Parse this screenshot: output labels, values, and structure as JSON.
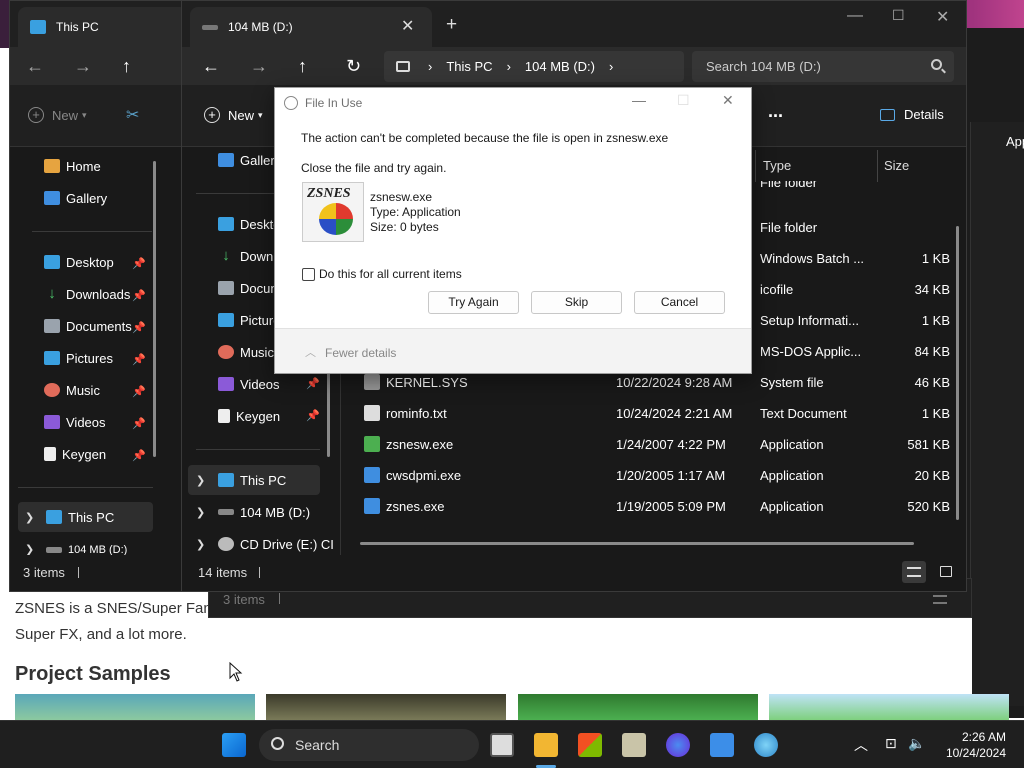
{
  "web": {
    "line1": "ZSNES is a SNES/Super Fam",
    "line2": "Super FX, and a lot more.",
    "heading": "Project Samples"
  },
  "ghost_app": {
    "label": "App"
  },
  "window1": {
    "tab_title": "This PC",
    "new_label": "New",
    "sidebar": [
      {
        "label": "Home",
        "icon": "home-icon"
      },
      {
        "label": "Gallery",
        "icon": "gallery-icon"
      },
      {
        "label": "Desktop",
        "icon": "desktop-icon"
      },
      {
        "label": "Downloads",
        "icon": "download-icon"
      },
      {
        "label": "Documents",
        "icon": "document-icon"
      },
      {
        "label": "Pictures",
        "icon": "pictures-icon"
      },
      {
        "label": "Music",
        "icon": "music-icon"
      },
      {
        "label": "Videos",
        "icon": "videos-icon"
      },
      {
        "label": "Keygen",
        "icon": "file-icon"
      },
      {
        "label": "This PC",
        "icon": "pc-icon"
      },
      {
        "label": "104 MB (D:)",
        "icon": "drive-icon"
      }
    ],
    "status": "3 items"
  },
  "window3": {
    "status": "3 items"
  },
  "window2": {
    "tab_title": "104 MB (D:)",
    "add_tab": "+",
    "breadcrumb": [
      "This PC",
      "104 MB (D:)"
    ],
    "search_placeholder": "Search 104 MB (D:)",
    "new_label": "New",
    "more_label": "...",
    "details_label": "Details",
    "sidebar": [
      {
        "label": "Gallery"
      },
      {
        "label": "Deskto"
      },
      {
        "label": "Downl"
      },
      {
        "label": "Docun"
      },
      {
        "label": "Picture"
      },
      {
        "label": "Music"
      },
      {
        "label": "Videos"
      },
      {
        "label": "Keygen"
      },
      {
        "label": "This PC"
      },
      {
        "label": "104 MB (D:)"
      },
      {
        "label": "CD Drive (E:) CI"
      }
    ],
    "columns": {
      "type": "Type",
      "size": "Size"
    },
    "rows": [
      {
        "name": "",
        "date": "",
        "type": "File folder",
        "size": ""
      },
      {
        "name": "",
        "date": "",
        "type": "File folder",
        "size": ""
      },
      {
        "name": "",
        "date": "",
        "type": "Windows Batch ...",
        "size": "1 KB"
      },
      {
        "name": "",
        "date": "",
        "type": "icofile",
        "size": "34 KB"
      },
      {
        "name": "",
        "date": "",
        "type": "Setup Informati...",
        "size": "1 KB"
      },
      {
        "name": "",
        "date": "",
        "type": "MS-DOS Applic...",
        "size": "84 KB"
      },
      {
        "name": "KERNEL.SYS",
        "date": "10/22/2024 9:28 AM",
        "type": "System file",
        "size": "46 KB"
      },
      {
        "name": "rominfo.txt",
        "date": "10/24/2024 2:21 AM",
        "type": "Text Document",
        "size": "1 KB"
      },
      {
        "name": "zsnesw.exe",
        "date": "1/24/2007 4:22 PM",
        "type": "Application",
        "size": "581 KB"
      },
      {
        "name": "cwsdpmi.exe",
        "date": "1/20/2005 1:17 AM",
        "type": "Application",
        "size": "20 KB"
      },
      {
        "name": "zsnes.exe",
        "date": "1/19/2005 5:09 PM",
        "type": "Application",
        "size": "520 KB"
      }
    ],
    "status": "14 items"
  },
  "dialog": {
    "title": "File In Use",
    "message": "The action can't be completed because the file is open in zsnesw.exe",
    "instruction": "Close the file and try again.",
    "file_name": "zsnesw.exe",
    "file_type": "Type: Application",
    "file_size": "Size: 0 bytes",
    "icon_logo": "ZSNES",
    "checkbox_label": "Do this for all current items",
    "btn_try": "Try Again",
    "btn_skip": "Skip",
    "btn_cancel": "Cancel",
    "fewer_details": "Fewer details"
  },
  "taskbar": {
    "search_label": "Search",
    "time": "2:26 AM",
    "date": "10/24/2024"
  }
}
